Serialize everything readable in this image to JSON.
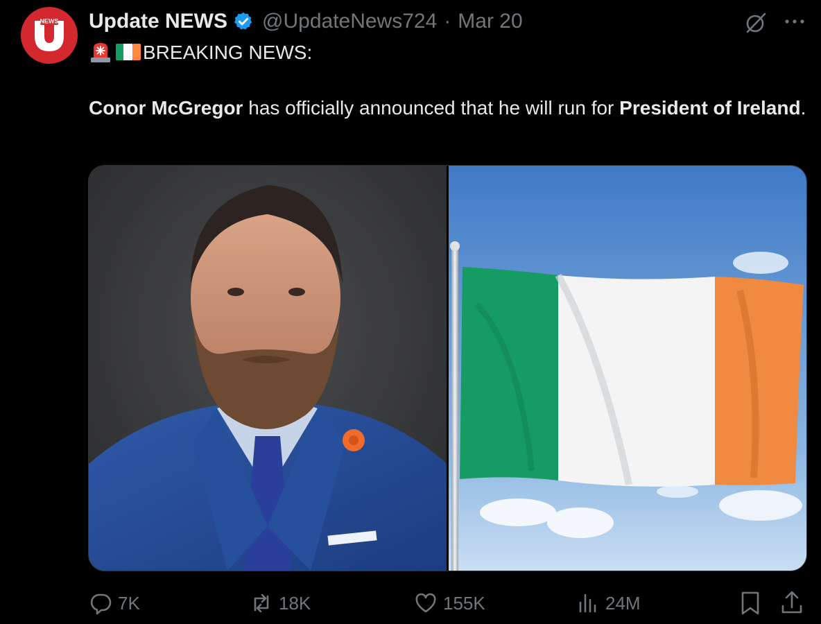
{
  "author": {
    "display_name": "Update NEWS",
    "handle": "@UpdateNews724",
    "separator": "·",
    "timestamp": "Mar 20",
    "avatar_badge_text": "NEWS"
  },
  "tweet": {
    "headline": "BREAKING NEWS:",
    "body_bold_1": "Conor McGregor",
    "body_plain_1": " has officially announced that he will run for ",
    "body_bold_2": "President of Ireland",
    "body_plain_2": "."
  },
  "icons": {
    "siren": "police-siren-emoji",
    "flag": "ireland-flag-emoji",
    "verified": "verified-badge-icon",
    "grok": "grok-icon",
    "more": "more-icon"
  },
  "actions": {
    "replies": "7K",
    "reposts": "18K",
    "likes": "155K",
    "views": "24M"
  },
  "colors": {
    "background": "#000000",
    "text": "#e7e9ea",
    "muted": "#71767b",
    "verified": "#1d9bf0",
    "avatar": "#d3282d",
    "flag_green": "#169b62",
    "flag_white": "#ffffff",
    "flag_orange": "#ff883e"
  }
}
